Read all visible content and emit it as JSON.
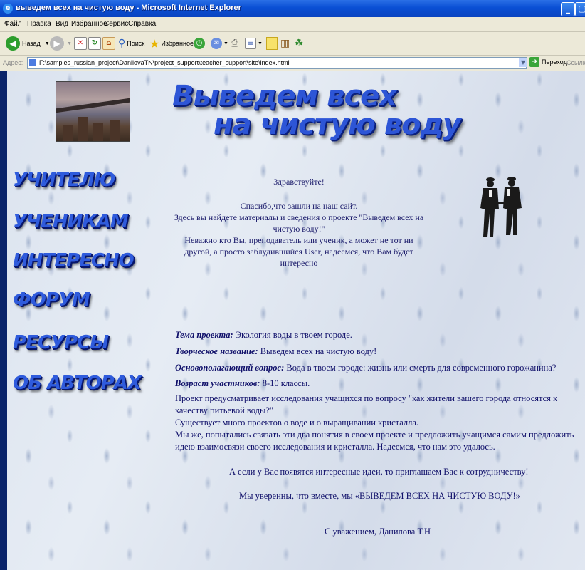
{
  "window": {
    "title": "выведем всех на чистую воду - Microsoft Internet Explorer",
    "min_glyph": "_",
    "max_glyph": "▢"
  },
  "menu": {
    "items": [
      "Файл",
      "Правка",
      "Вид",
      "Избранное",
      "Сервис",
      "Справка"
    ]
  },
  "toolbar": {
    "back_label": "Назад",
    "search_label": "Поиск",
    "favorites_label": "Избранное"
  },
  "address": {
    "label": "Адрес:",
    "url": "F:\\samples_russian_project\\DanilovaTN\\project_support\\teacher_support\\site\\index.html",
    "go_label": "Переход",
    "links_label": "Ссылки"
  },
  "site": {
    "title_line1": "Выведем всех",
    "title_line2": "на чистую воду",
    "nav": [
      "УЧИТЕЛЮ",
      "УЧЕНИКАМ",
      "ИНТЕРЕСНО",
      "ФОРУМ",
      "РЕСУРСЫ",
      "ОБ АВТОРАХ"
    ],
    "greeting": "Здравствуйте!",
    "welcome": "Спасибо,что зашли на наш сайт.\nЗдесь вы найдете материалы и сведения о проекте \"Выведем всех на чистую воду!\"\nНеважно кто Вы, преподаватель или ученик, а может не тот ни другой, а просто заблудившийся User, надеемся, что Вам будет интересно",
    "project_topic_label": "Тема проекта:",
    "project_topic": "Экология воды в твоем городе.",
    "creative_name_label": "Творческое название:",
    "creative_name": "Выведем всех на чистую воду!",
    "key_question_label": "Основополагающий вопрос:",
    "key_question": "Вода в твоем городе: жизнь или смерть для современного горожанина?",
    "age_label": "Возраст участников:",
    "age": "8-10 классы.",
    "description": "Проект предусматривает исследования учащихся по вопросу \"как жители вашего города относятся к качеству питьевой воды?\"\nСуществует много проектов о воде и о выращивании кристалла.\nМы же, попытались связать эти два понятия в своем проекте и предложить учащимся самим предложить идею взаимосвязи своего исследования и кристалла. Надеемся, что нам это удалось.",
    "invite": "А если у Вас появятся интересные идеи, то приглашаем Вас к сотрудничеству!",
    "together": "Мы уверенны, что вместе, мы «ВЫВЕДЕМ ВСЕХ НА ЧИСТУЮ ВОДУ!»",
    "signature": "С уважением, Данилова Т.Н"
  }
}
